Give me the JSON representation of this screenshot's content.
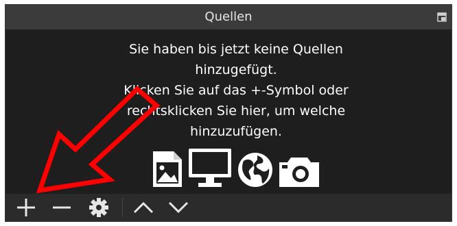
{
  "panel": {
    "title": "Quellen"
  },
  "empty_state": {
    "lines": [
      "Sie haben bis jetzt keine Quellen",
      "hinzugefügt.",
      "Klicken Sie auf das +-Symbol oder",
      "rechtsklicken Sie hier, um welche",
      "hinzuzufügen."
    ],
    "icons": [
      "image-icon",
      "monitor-icon",
      "globe-icon",
      "camera-icon"
    ]
  },
  "toolbar": {
    "buttons": [
      "add-icon",
      "remove-icon",
      "settings-icon",
      "move-up-icon",
      "move-down-icon"
    ]
  },
  "colors": {
    "panel_bg": "#1e1e1e",
    "titlebar_bg": "#3b3b3b",
    "toolbar_bg": "#2b2b2b",
    "text": "#ffffff",
    "annotation_arrow": "#ff0000"
  }
}
